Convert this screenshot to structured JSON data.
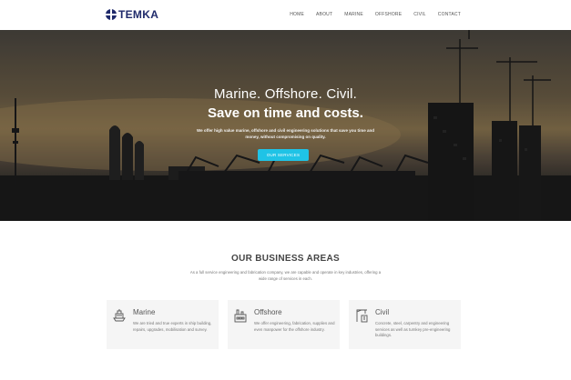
{
  "header": {
    "logo_text": "TEMKA",
    "nav": [
      "HOME",
      "ABOUT",
      "MARINE",
      "OFFSHORE",
      "CIVIL",
      "CONTACT"
    ]
  },
  "hero": {
    "title": "Marine. Offshore. Civil.",
    "subtitle": "Save on time and costs.",
    "description": "We offer high value marine, offshore and civil engineering solutions that save you time and money, without compromising on quality.",
    "button_label": "OUR SERVICES"
  },
  "business": {
    "title": "OUR BUSINESS AREAS",
    "description": "As a full service engineering and fabrication company, we are capable and operate in key industries, offering a wide range of services in each.",
    "cards": [
      {
        "title": "Marine",
        "icon": "ship-icon",
        "text": "We are tried and true experts in ship building, repairs, upgrades, mobilisation and survey."
      },
      {
        "title": "Offshore",
        "icon": "factory-icon",
        "text": "We offer engineering, fabrication, supplies and even manpower for the offshore industry."
      },
      {
        "title": "Civil",
        "icon": "crane-building-icon",
        "text": "Concrete, steel, carpentry and engineering services as well as turnkey pre-engineering buildings."
      }
    ]
  },
  "colors": {
    "brand": "#1f2a6b",
    "accent": "#1fc3e6",
    "card_bg": "#f5f5f5"
  }
}
